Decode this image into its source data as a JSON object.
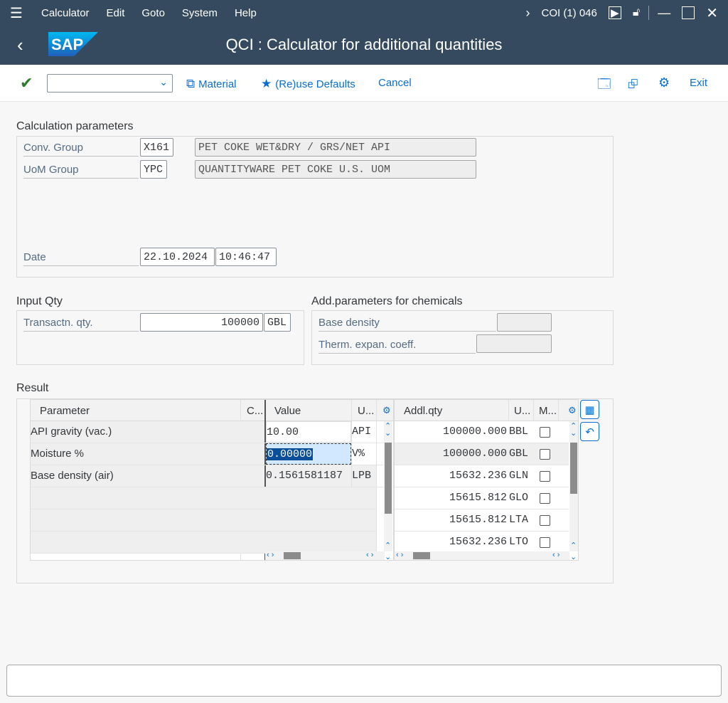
{
  "menubar": {
    "items": [
      "Calculator",
      "Edit",
      "Goto",
      "System",
      "Help"
    ],
    "session": "COI (1) 046"
  },
  "titlebar": {
    "logo_text": "SAP",
    "title": "QCI : Calculator for additional quantities"
  },
  "toolbar": {
    "command_value": "",
    "material_label": "Material",
    "reuse_label": "(Re)use Defaults",
    "cancel_label": "Cancel",
    "exit_label": "Exit"
  },
  "calc_params": {
    "title": "Calculation parameters",
    "conv_group_label": "Conv. Group",
    "conv_group_value": "X161",
    "conv_group_desc": "PET COKE WET&DRY / GRS/NET API",
    "uom_group_label": "UoM Group",
    "uom_group_value": "YPC",
    "uom_group_desc": "QUANTITYWARE PET COKE U.S. UOM",
    "date_label": "Date",
    "date_value": "22.10.2024",
    "time_value": "10:46:47"
  },
  "input_qty": {
    "title": "Input Qty",
    "label": "Transactn. qty.",
    "value": "100000",
    "unit": "GBL"
  },
  "chem_params": {
    "title": "Add.parameters for chemicals",
    "base_density_label": "Base density",
    "base_density_value": "",
    "therm_label": "Therm. expan. coeff.",
    "therm_value": ""
  },
  "result": {
    "title": "Result",
    "left_headers": {
      "param": "Parameter",
      "c": "C...",
      "value": "Value",
      "u": "U..."
    },
    "left_rows": [
      {
        "param": "API gravity (vac.)",
        "value": "10.00",
        "unit": "API"
      },
      {
        "param": "Moisture %",
        "value": "0.00000",
        "unit": "V%"
      },
      {
        "param": "Base density (air)",
        "value": "0.1561581187",
        "unit": "LPB"
      }
    ],
    "right_headers": {
      "qty": "Addl.qty",
      "u": "U...",
      "m": "M..."
    },
    "right_rows": [
      {
        "qty": "100000.000",
        "unit": "BBL"
      },
      {
        "qty": "100000.000",
        "unit": "GBL"
      },
      {
        "qty": "15632.236",
        "unit": "GLN"
      },
      {
        "qty": "15615.812",
        "unit": "GLO"
      },
      {
        "qty": "15615.812",
        "unit": "LTA"
      },
      {
        "qty": "15632.236",
        "unit": "LTO"
      }
    ]
  },
  "statusbar": {
    "text": ""
  }
}
